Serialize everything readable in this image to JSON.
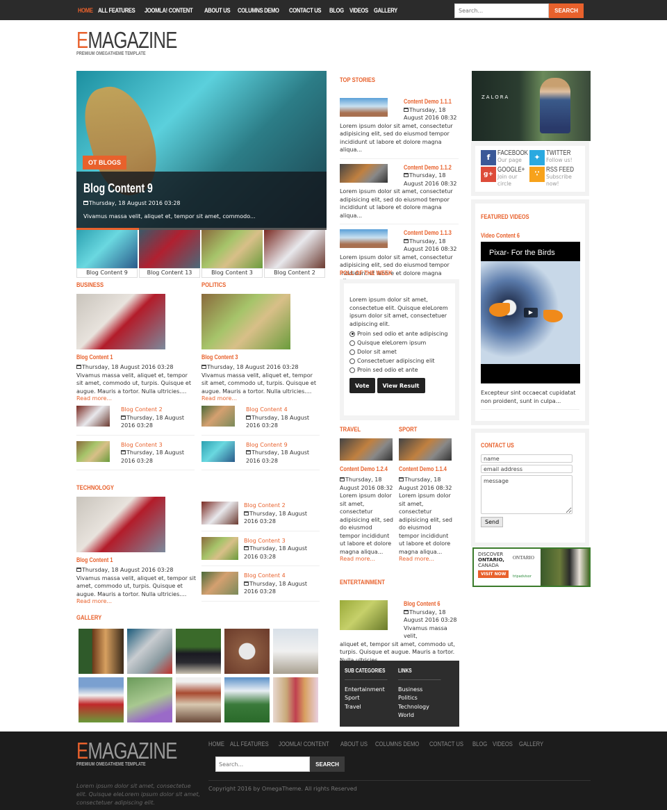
{
  "topnav": {
    "items": [
      "HOME",
      "ALL FEATURES",
      "JOOMLA! CONTENT",
      "ABOUT US",
      "COLUMNS DEMO",
      "CONTACT US",
      "BLOG",
      "VIDEOS",
      "GALLERY"
    ],
    "active": "HOME",
    "search_placeholder": "Search...",
    "search_button": "SEARCH"
  },
  "logo": {
    "first_letter": "E",
    "rest": "MAGAZINE",
    "tagline": "PREMIUM OMEGATHEME TEMPLATE"
  },
  "hero": {
    "category": "OT BLOGS",
    "title": "Blog Content 9",
    "date": "Thursday, 18 August 2016 03:28",
    "intro": "Vivamus massa velit, aliquet et, tempor sit amet, commodo...",
    "slides": [
      "Blog Content 9",
      "Blog Content 13",
      "Blog Content 3",
      "Blog Content 2"
    ],
    "slide_progress": 0.25
  },
  "business": {
    "heading": "BUSINESS",
    "main": {
      "title": "Blog Content 1",
      "date": "Thursday, 18 August 2016 03:28",
      "text": "Vivamus massa velit, aliquet et, tempor sit amet, commodo ut, turpis. Quisque et augue. Mauris a tortor. Nulla ultricies....",
      "readmore": "Read more..."
    },
    "list": [
      {
        "title": "Blog Content 2",
        "date": "Thursday, 18 August 2016 03:28"
      },
      {
        "title": "Blog Content 3",
        "date": "Thursday, 18 August 2016 03:28"
      }
    ]
  },
  "politics": {
    "heading": "POLITICS",
    "main": {
      "title": "Blog Content 3",
      "date": "Thursday, 18 August 2016 03:28",
      "text": "Vivamus massa velit, aliquet et, tempor sit amet, commodo ut, turpis. Quisque et augue. Mauris a tortor. Nulla ultricies....",
      "readmore": "Read more..."
    },
    "list": [
      {
        "title": "Blog Content 4",
        "date": "Thursday, 18 August 2016 03:28"
      },
      {
        "title": "Blog Content 9",
        "date": "Thursday, 18 August 2016 03:28"
      }
    ]
  },
  "technology": {
    "heading": "TECHNOLOGY",
    "main": {
      "title": "Blog Content 1",
      "date": "Thursday, 18 August 2016 03:28",
      "text": "Vivamus massa velit, aliquet et, tempor sit amet, commodo ut, turpis. Quisque et augue. Mauris a tortor. Nulla ultricies....",
      "readmore": "Read more..."
    },
    "list": [
      {
        "title": "Blog Content 2",
        "date": "Thursday, 18 August 2016 03:28"
      },
      {
        "title": "Blog Content 3",
        "date": "Thursday, 18 August 2016 03:28"
      },
      {
        "title": "Blog Content 4",
        "date": "Thursday, 18 August 2016 03:28"
      }
    ]
  },
  "gallery": {
    "heading": "GALLERY"
  },
  "top_stories": {
    "heading": "TOP STORIES",
    "items": [
      {
        "title": "Content Demo 1.1.1",
        "date": "Thursday, 18 August 2016 08:32",
        "text": "Lorem ipsum dolor sit amet, consectetur adipisicing elit, sed do eiusmod tempor incididunt ut labore et dolore magna aliqua..."
      },
      {
        "title": "Content Demo 1.1.2",
        "date": "Thursday, 18 August 2016 08:32",
        "text": "Lorem ipsum dolor sit amet, consectetur adipisicing elit, sed do eiusmod tempor incididunt ut labore et dolore magna aliqua..."
      },
      {
        "title": "Content Demo 1.1.3",
        "date": "Thursday, 18 August 2016 08:32",
        "text": "Lorem ipsum dolor sit amet, consectetur adipisicing elit, sed do eiusmod tempor incididunt ut labore et dolore magna aliqua..."
      }
    ]
  },
  "poll": {
    "heading": "POLL OF THE WEEK",
    "question": "Lorem ipsum dolor sit amet, consectetue elit. Quisque eleLorem ipsum dolor sit amet, consectetuer adipiscing elit.",
    "options": [
      "Proin sed odio et ante adipiscing",
      "Quisque eleLorem ipsum",
      "Dolor sit amet",
      "Consectetuer adipiscing elit",
      "Proin sed odio et ante"
    ],
    "selected": 0,
    "vote": "Vote",
    "view_result": "View Result"
  },
  "travel": {
    "heading": "TRAVEL",
    "title": "Content Demo 1.2.4",
    "date": "Thursday, 18 August 2016 08:32",
    "text": "Lorem ipsum dolor sit amet, consectetur adipisicing elit, sed do eiusmod tempor incididunt ut labore et dolore magna aliqua...",
    "readmore": "Read more..."
  },
  "sport": {
    "heading": "SPORT",
    "title": "Content Demo 1.1.4",
    "date": "Thursday, 18 August 2016 08:32",
    "text": "Lorem ipsum dolor sit amet, consectetur adipisicing elit, sed do eiusmod tempor incididunt ut labore et dolore magna aliqua...",
    "readmore": "Read more..."
  },
  "entertainment": {
    "heading": "ENTERTAINMENT",
    "title": "Blog Content 6",
    "date": "Thursday, 18 August 2016 03:28",
    "text_right": "Vivamus massa velit,",
    "text": "aliquet et, tempor sit amet, commodo ut, turpis. Quisque et augue. Mauris a tortor. Nulla ultricies...."
  },
  "subcats": {
    "heading": "SUB CATEGORIES",
    "items": [
      "Entertainment",
      "Sport",
      "Travel"
    ]
  },
  "links": {
    "heading": "LINKS",
    "items": [
      "Business",
      "Politics",
      "Technology",
      "World"
    ]
  },
  "ad_top": {
    "brand": "ZALORA"
  },
  "social": [
    {
      "name": "FACEBOOK",
      "sub": "Our page",
      "icon": "f",
      "color": "#3b5998"
    },
    {
      "name": "TWITTER",
      "sub": "Follow us!",
      "icon": "t",
      "color": "#2aa9e0"
    },
    {
      "name": "GOOGLE+",
      "sub": "Join our circle",
      "icon": "g+",
      "color": "#dd4b39"
    },
    {
      "name": "RSS FEED",
      "sub": "Subscribe now!",
      "icon": "rss",
      "color": "#f7a21b"
    }
  ],
  "videos": {
    "heading": "FEATURED VIDEOS",
    "title": "Video Content 6",
    "video_title": "Pixar- For the Birds",
    "text": "Excepteur sint occaecat cupidatat non proident, sunt in culpa..."
  },
  "contact": {
    "heading": "CONTACT US",
    "name": "name",
    "email": "email address",
    "message": "message",
    "send": "Send"
  },
  "ad_bottom": {
    "line1": "DISCOVER",
    "line2": "ONTARIO,",
    "line3": "CANADA",
    "cta": "VISIT NOW",
    "brand": "ONTARIO",
    "partner": "tripadvisor"
  },
  "footer": {
    "nav": [
      "HOME",
      "ALL FEATURES",
      "JOOMLA! CONTENT",
      "ABOUT US",
      "COLUMNS DEMO",
      "CONTACT US",
      "BLOG",
      "VIDEOS",
      "GALLERY"
    ],
    "search_placeholder": "Search...",
    "search_button": "SEARCH",
    "description": "Lorem ipsum dolor sit amet, consectetue elit. Quisque eleLorem ipsum dolor sit amet, consectetuer adipiscing elit.",
    "copyright": "Copyright 2016 by OmegaTheme. All rights Reserved"
  },
  "colors": {
    "accent": "#e8612c",
    "topbar": "#2b2b2b",
    "footer": "#1c1c1c"
  }
}
